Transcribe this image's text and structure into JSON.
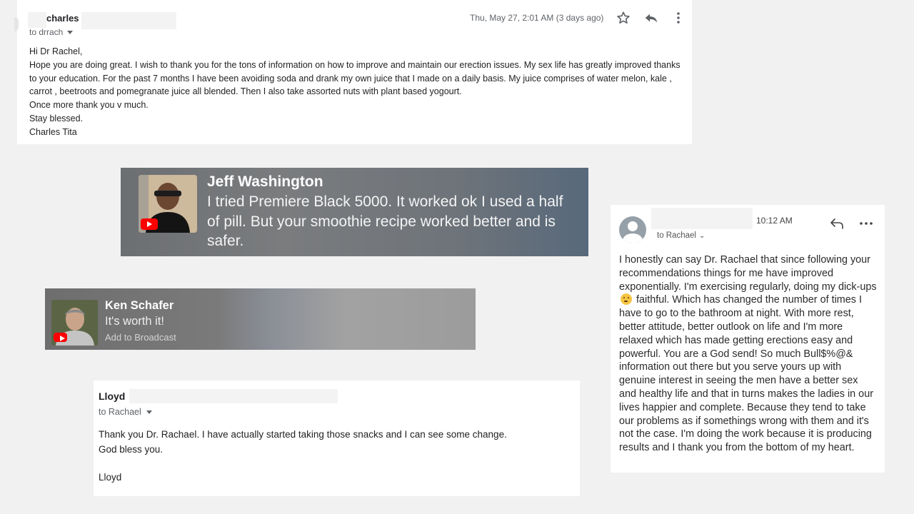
{
  "card1": {
    "sender": "charles",
    "to": "to drrach",
    "date": "Thu, May 27, 2:01 AM (3 days ago)",
    "icons": {
      "star": "star-icon",
      "reply": "reply-icon",
      "more": "more-vert-icon"
    },
    "body": [
      "Hi Dr Rachel,",
      "Hope you are doing great. I wish to thank you for the tons of information on how to improve and maintain our erection issues. My sex life has greatly improved thanks to your education. For the past 7 months I have been avoiding soda and drank my own juice that I made on a daily basis. My juice comprises of water melon, kale , carrot , beetroots and pomegranate juice all blended.  Then I also take assorted nuts with plant based yogourt.",
      "Once more thank you v much.",
      "Stay blessed.",
      "Charles Tita"
    ]
  },
  "card2": {
    "name": "Jeff Washington",
    "text": "I tried Premiere Black 5000. It worked ok I used a half of pill. But your smoothie recipe worked better and is safer.",
    "badge": "youtube-icon"
  },
  "card3": {
    "name": "Ken Schafer",
    "text": "It's worth it!",
    "action": "Add to Broadcast",
    "badge": "youtube-icon"
  },
  "card4": {
    "sender": "Lloyd",
    "to": "to Rachael",
    "body": [
      "Thank you Dr. Rachael. I have actually started taking those snacks and I can see some change.",
      "God bless you."
    ],
    "signature": "Lloyd"
  },
  "card5": {
    "time": "10:12 AM",
    "to": "to Rachael",
    "caret": "⌄",
    "body_before_emoji": "I honestly can say Dr. Rachael that since following your recommendations things for me have improved exponentially. I'm exercising regularly, doing my dick-ups",
    "body_after_emoji": "faithful. Which has changed the number of times I have to go to the bathroom at night. With more rest, better attitude, better outlook on life and I'm more relaxed which has made getting erections easy and powerful. You are a God send! So much Bull$%@& information out there but you serve yours up with genuine interest in seeing the men have a better sex and healthy life and that in turns makes the ladies in our lives happier and complete. Because they tend to take our problems as if somethings wrong with them and it's not the case. I'm doing the work because it is producing results and I thank you from the bottom of my heart."
  }
}
